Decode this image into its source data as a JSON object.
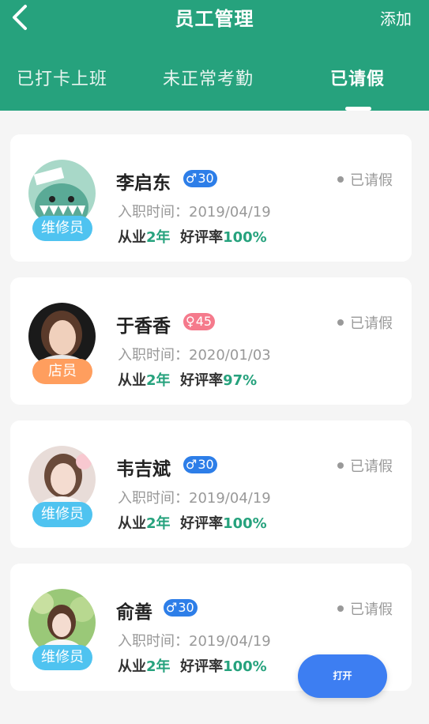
{
  "header": {
    "title": "员工管理",
    "add_label": "添加"
  },
  "tabs": [
    {
      "label": "已打卡上班",
      "active": false
    },
    {
      "label": "未正常考勤",
      "active": false
    },
    {
      "label": "已请假",
      "active": true
    }
  ],
  "employees": [
    {
      "name": "李启东",
      "gender": "male",
      "gender_symbol": "♂",
      "age": "30",
      "entry_text": "入职时间：2019/04/19",
      "years_prefix": "从业",
      "years_value": "2年",
      "rating_prefix": "好评率",
      "rating_value": "100%",
      "role": "维修员",
      "status": "已请假"
    },
    {
      "name": "于香香",
      "gender": "female",
      "gender_symbol": "♀",
      "age": "45",
      "entry_text": "入职时间：2020/01/03",
      "years_prefix": "从业",
      "years_value": "2年",
      "rating_prefix": "好评率",
      "rating_value": "97%",
      "role": "店员",
      "status": "已请假"
    },
    {
      "name": "韦吉斌",
      "gender": "male",
      "gender_symbol": "♂",
      "age": "30",
      "entry_text": "入职时间：2019/04/19",
      "years_prefix": "从业",
      "years_value": "2年",
      "rating_prefix": "好评率",
      "rating_value": "100%",
      "role": "维修员",
      "status": "已请假"
    },
    {
      "name": "俞善",
      "gender": "male",
      "gender_symbol": "♂",
      "age": "30",
      "entry_text": "入职时间：2019/04/19",
      "years_prefix": "从业",
      "years_value": "2年",
      "rating_prefix": "好评率",
      "rating_value": "100%",
      "role": "维修员",
      "status": "已请假"
    }
  ],
  "fab": {
    "label": "打开"
  },
  "colors": {
    "primary": "#26a27d",
    "male_badge": "#2d7ee8",
    "female_badge": "#f57a8c",
    "role_repair": "#4fc3f0",
    "role_clerk": "#ff9e5e",
    "fab": "#3d7ef2"
  }
}
